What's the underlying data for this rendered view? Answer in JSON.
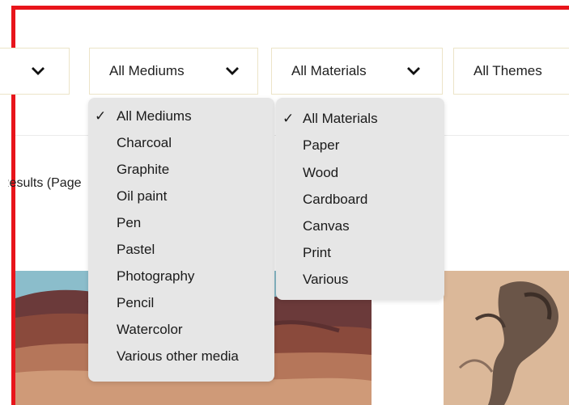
{
  "filters": {
    "first": {
      "label": ""
    },
    "mediums": {
      "label": "All Mediums"
    },
    "materials": {
      "label": "All Materials"
    },
    "themes": {
      "label": "All Themes"
    }
  },
  "results_text": "Results (Page",
  "mediums_dropdown": {
    "selected": "All Mediums",
    "items": [
      "All Mediums",
      "Charcoal",
      "Graphite",
      "Oil paint",
      "Pen",
      "Pastel",
      "Photography",
      "Pencil",
      "Watercolor",
      "Various other media"
    ]
  },
  "materials_dropdown": {
    "selected": "All Materials",
    "items": [
      "All Materials",
      "Paper",
      "Wood",
      "Cardboard",
      "Canvas",
      "Print",
      "Various"
    ]
  },
  "check_glyph": "✓",
  "colors": {
    "frame_accent": "#e8151b",
    "dropdown_bg": "#e6e6e6",
    "filter_border": "#ece4c8"
  },
  "icons": [
    "chevron-down-icon",
    "check-icon"
  ]
}
